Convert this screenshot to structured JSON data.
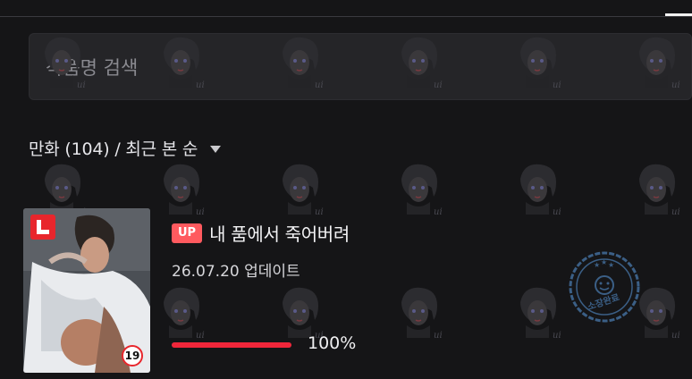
{
  "search": {
    "placeholder": "작품명 검색",
    "value": ""
  },
  "list_header": {
    "sort_label": "만화 (104) / 최근 본 순"
  },
  "items": [
    {
      "up_badge": "UP",
      "title": "내 품에서 죽어버려",
      "update_text": "26.07.20 업데이트",
      "age_rating": "19",
      "progress_percent": 100,
      "progress_text": "100%",
      "stamp_text": "소장완료"
    }
  ],
  "colors": {
    "accent_red": "#f0263a",
    "up_badge": "#ff5a5f",
    "stamp": "#3b5f86",
    "background": "#151517"
  },
  "icons": [
    "chevron-down-icon",
    "platform-logo-icon",
    "age-19-icon",
    "owned-stamp-icon",
    "watermark-icon"
  ]
}
